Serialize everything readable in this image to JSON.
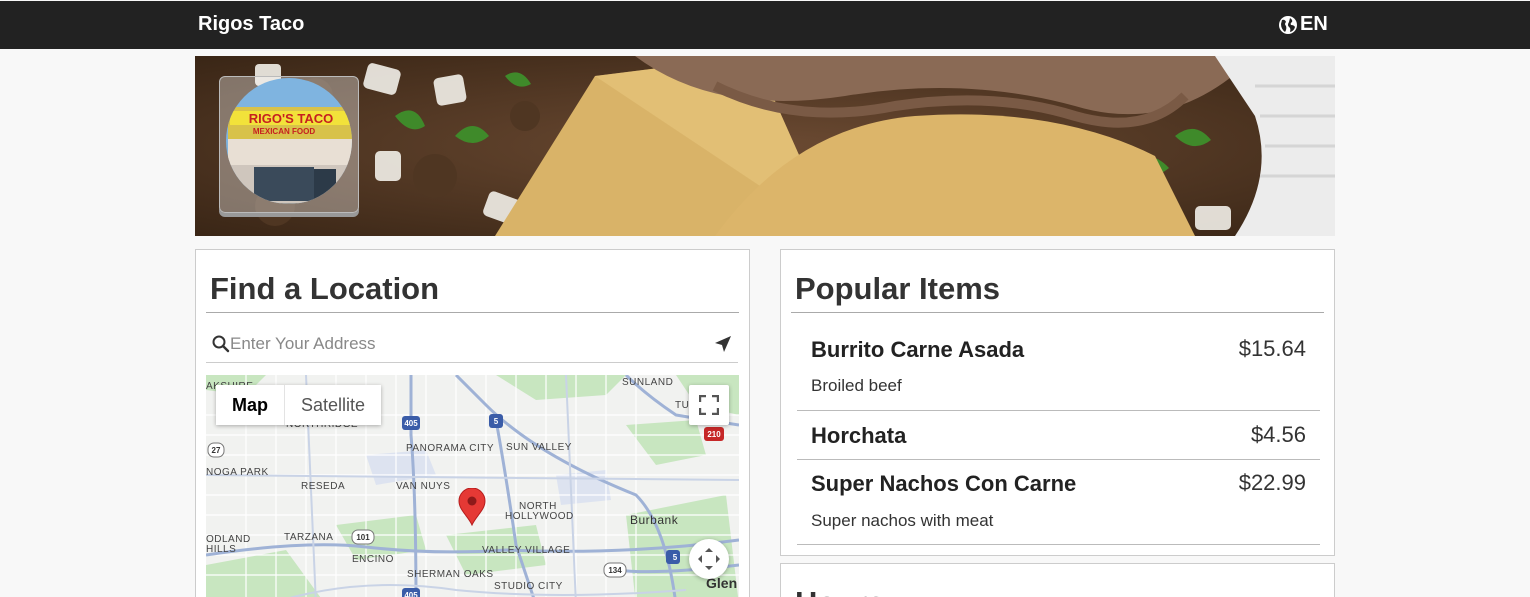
{
  "header": {
    "brand": "Rigos Taco",
    "language": "EN",
    "language_icon": "globe-icon"
  },
  "banner": {
    "logo_sign_line1": "RIGO'S TACO",
    "logo_sign_line2": "MEXICAN FOOD"
  },
  "find_location": {
    "title": "Find a Location",
    "search_placeholder": "Enter Your Address",
    "map": {
      "type_map": "Map",
      "type_satellite": "Satellite",
      "labels": [
        "SUNLAND",
        "NORTHRIDGE",
        "PANORAMA CITY",
        "SUN VALLEY",
        "NOGA PARK",
        "RESEDA",
        "VAN NUYS",
        "NORTH",
        "HOLLYWOOD",
        "Burbank",
        "TARZANA",
        "ODLAND",
        "HILLS",
        "ENCINO",
        "VALLEY VILLAGE",
        "SHERMAN OAKS",
        "STUDIO CITY",
        "Glen",
        "TU",
        "AKSHIRE"
      ],
      "shields": [
        "405",
        "5",
        "210",
        "27",
        "101",
        "134",
        "5",
        "405"
      ]
    }
  },
  "popular_items": {
    "title": "Popular Items",
    "items": [
      {
        "name": "Burrito Carne Asada",
        "price": "$15.64",
        "description": "Broiled beef"
      },
      {
        "name": "Horchata",
        "price": "$4.56",
        "description": ""
      },
      {
        "name": "Super Nachos Con Carne",
        "price": "$22.99",
        "description": "Super nachos with meat"
      }
    ]
  },
  "hours": {
    "title": "Hours"
  },
  "colors": {
    "topbar": "#222222",
    "pin": "#e53935",
    "background": "#f8f8f8"
  }
}
